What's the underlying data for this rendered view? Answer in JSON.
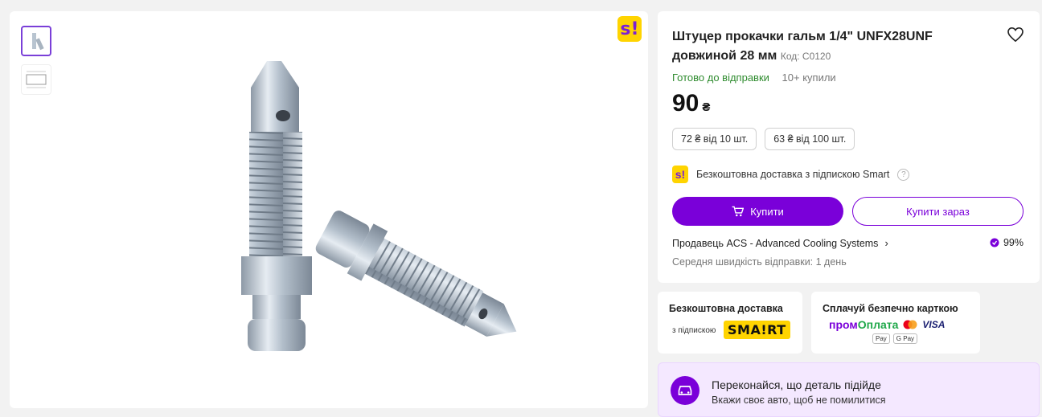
{
  "gallery": {
    "thumbnails": [
      "bleeder-screws-photo",
      "bleeder-screw-drawing"
    ],
    "badge": "s!"
  },
  "product": {
    "title": "Штуцер прокачки гальм 1/4\" UNFX28UNF довжиной 28 мм",
    "code_label": "Код: С0120",
    "status": "Готово до відправки",
    "bought": "10+ купили",
    "price": "90",
    "currency": "₴",
    "tiers": [
      "72 ₴ від 10 шт.",
      "63 ₴ від 100 шт."
    ],
    "smart_delivery": "Безкоштовна доставка з підпискою Smart",
    "buy_label": "Купити",
    "buy_now_label": "Купити зараз",
    "seller": "Продавець ACS - Advanced Cooling Systems",
    "rating": "99%",
    "shipping_speed": "Середня швидкість відправки: 1 день"
  },
  "promo": {
    "smart_title": "Безкоштовна доставка",
    "smart_sub": "з підпискою",
    "smart_logo": "SMA!RT",
    "pay_title": "Сплачуй безпечно карткою",
    "prom_a": "пром",
    "prom_b": "Оплата",
    "visa": "VISA",
    "apple_pay": "Pay",
    "google_pay": "G Pay"
  },
  "car_banner": {
    "title": "Переконайся, що деталь підійде",
    "subtitle": "Вкажи своє авто, щоб не помилитися"
  },
  "colors": {
    "accent": "#7a00d9",
    "smart_yellow": "#ffd400",
    "ready_green": "#2e8b2e"
  }
}
